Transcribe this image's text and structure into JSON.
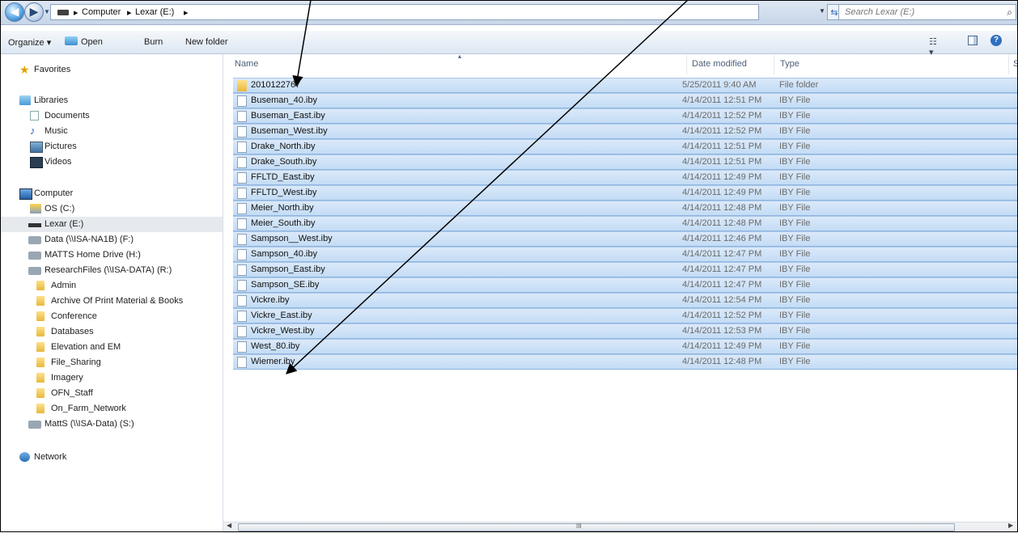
{
  "address": {
    "crumbs": [
      "Computer",
      "Lexar (E:)"
    ],
    "separator": "▸",
    "search_placeholder": "Search Lexar (E:)"
  },
  "toolbar": {
    "organize": "Organize ▾",
    "open": "Open",
    "burn": "Burn",
    "new_folder": "New folder"
  },
  "nav": {
    "favorites": "Favorites",
    "libraries": "Libraries",
    "documents": "Documents",
    "music": "Music",
    "pictures": "Pictures",
    "videos": "Videos",
    "computer": "Computer",
    "os": "OS (C:)",
    "lexar": "Lexar (E:)",
    "data": "Data (\\\\ISA-NA1B) (F:)",
    "matts_home": "MATTS Home Drive (H:)",
    "research": "ResearchFiles (\\\\ISA-DATA) (R:)",
    "folders": [
      "Admin",
      "Archive Of Print Material & Books",
      "Conference",
      "Databases",
      "Elevation and EM",
      "File_Sharing",
      "Imagery",
      "OFN_Staff",
      "On_Farm_Network"
    ],
    "matts_s": "MattS (\\\\ISA-Data) (S:)",
    "network": "Network"
  },
  "columns": {
    "name": "Name",
    "date": "Date modified",
    "type": "Type",
    "size": "S"
  },
  "files": [
    {
      "name": "2010122767",
      "date": "5/25/2011 9:40 AM",
      "type": "File folder",
      "icon": "folder-icon"
    },
    {
      "name": "Buseman_40.iby",
      "date": "4/14/2011 12:51 PM",
      "type": "IBY File",
      "icon": "file-icon"
    },
    {
      "name": "Buseman_East.iby",
      "date": "4/14/2011 12:52 PM",
      "type": "IBY File",
      "icon": "file-icon"
    },
    {
      "name": "Buseman_West.iby",
      "date": "4/14/2011 12:52 PM",
      "type": "IBY File",
      "icon": "file-icon"
    },
    {
      "name": "Drake_North.iby",
      "date": "4/14/2011 12:51 PM",
      "type": "IBY File",
      "icon": "file-icon"
    },
    {
      "name": "Drake_South.iby",
      "date": "4/14/2011 12:51 PM",
      "type": "IBY File",
      "icon": "file-icon"
    },
    {
      "name": "FFLTD_East.iby",
      "date": "4/14/2011 12:49 PM",
      "type": "IBY File",
      "icon": "file-icon"
    },
    {
      "name": "FFLTD_West.iby",
      "date": "4/14/2011 12:49 PM",
      "type": "IBY File",
      "icon": "file-icon"
    },
    {
      "name": "Meier_North.iby",
      "date": "4/14/2011 12:48 PM",
      "type": "IBY File",
      "icon": "file-icon"
    },
    {
      "name": "Meier_South.iby",
      "date": "4/14/2011 12:48 PM",
      "type": "IBY File",
      "icon": "file-icon"
    },
    {
      "name": "Sampson__West.iby",
      "date": "4/14/2011 12:46 PM",
      "type": "IBY File",
      "icon": "file-icon"
    },
    {
      "name": "Sampson_40.iby",
      "date": "4/14/2011 12:47 PM",
      "type": "IBY File",
      "icon": "file-icon"
    },
    {
      "name": "Sampson_East.iby",
      "date": "4/14/2011 12:47 PM",
      "type": "IBY File",
      "icon": "file-icon"
    },
    {
      "name": "Sampson_SE.iby",
      "date": "4/14/2011 12:47 PM",
      "type": "IBY File",
      "icon": "file-icon"
    },
    {
      "name": "Vickre.iby",
      "date": "4/14/2011 12:54 PM",
      "type": "IBY File",
      "icon": "file-icon"
    },
    {
      "name": "Vickre_East.iby",
      "date": "4/14/2011 12:52 PM",
      "type": "IBY File",
      "icon": "file-icon"
    },
    {
      "name": "Vickre_West.iby",
      "date": "4/14/2011 12:53 PM",
      "type": "IBY File",
      "icon": "file-icon"
    },
    {
      "name": "West_80.iby",
      "date": "4/14/2011 12:49 PM",
      "type": "IBY File",
      "icon": "file-icon"
    },
    {
      "name": "Wiemer.iby",
      "date": "4/14/2011 12:48 PM",
      "type": "IBY File",
      "icon": "file-icon"
    }
  ],
  "scrollbar": {
    "grip": "III"
  },
  "colors": {
    "selection": "#c3dcf5",
    "selection_border": "#8fb5df",
    "accent": "#2a63b5"
  }
}
